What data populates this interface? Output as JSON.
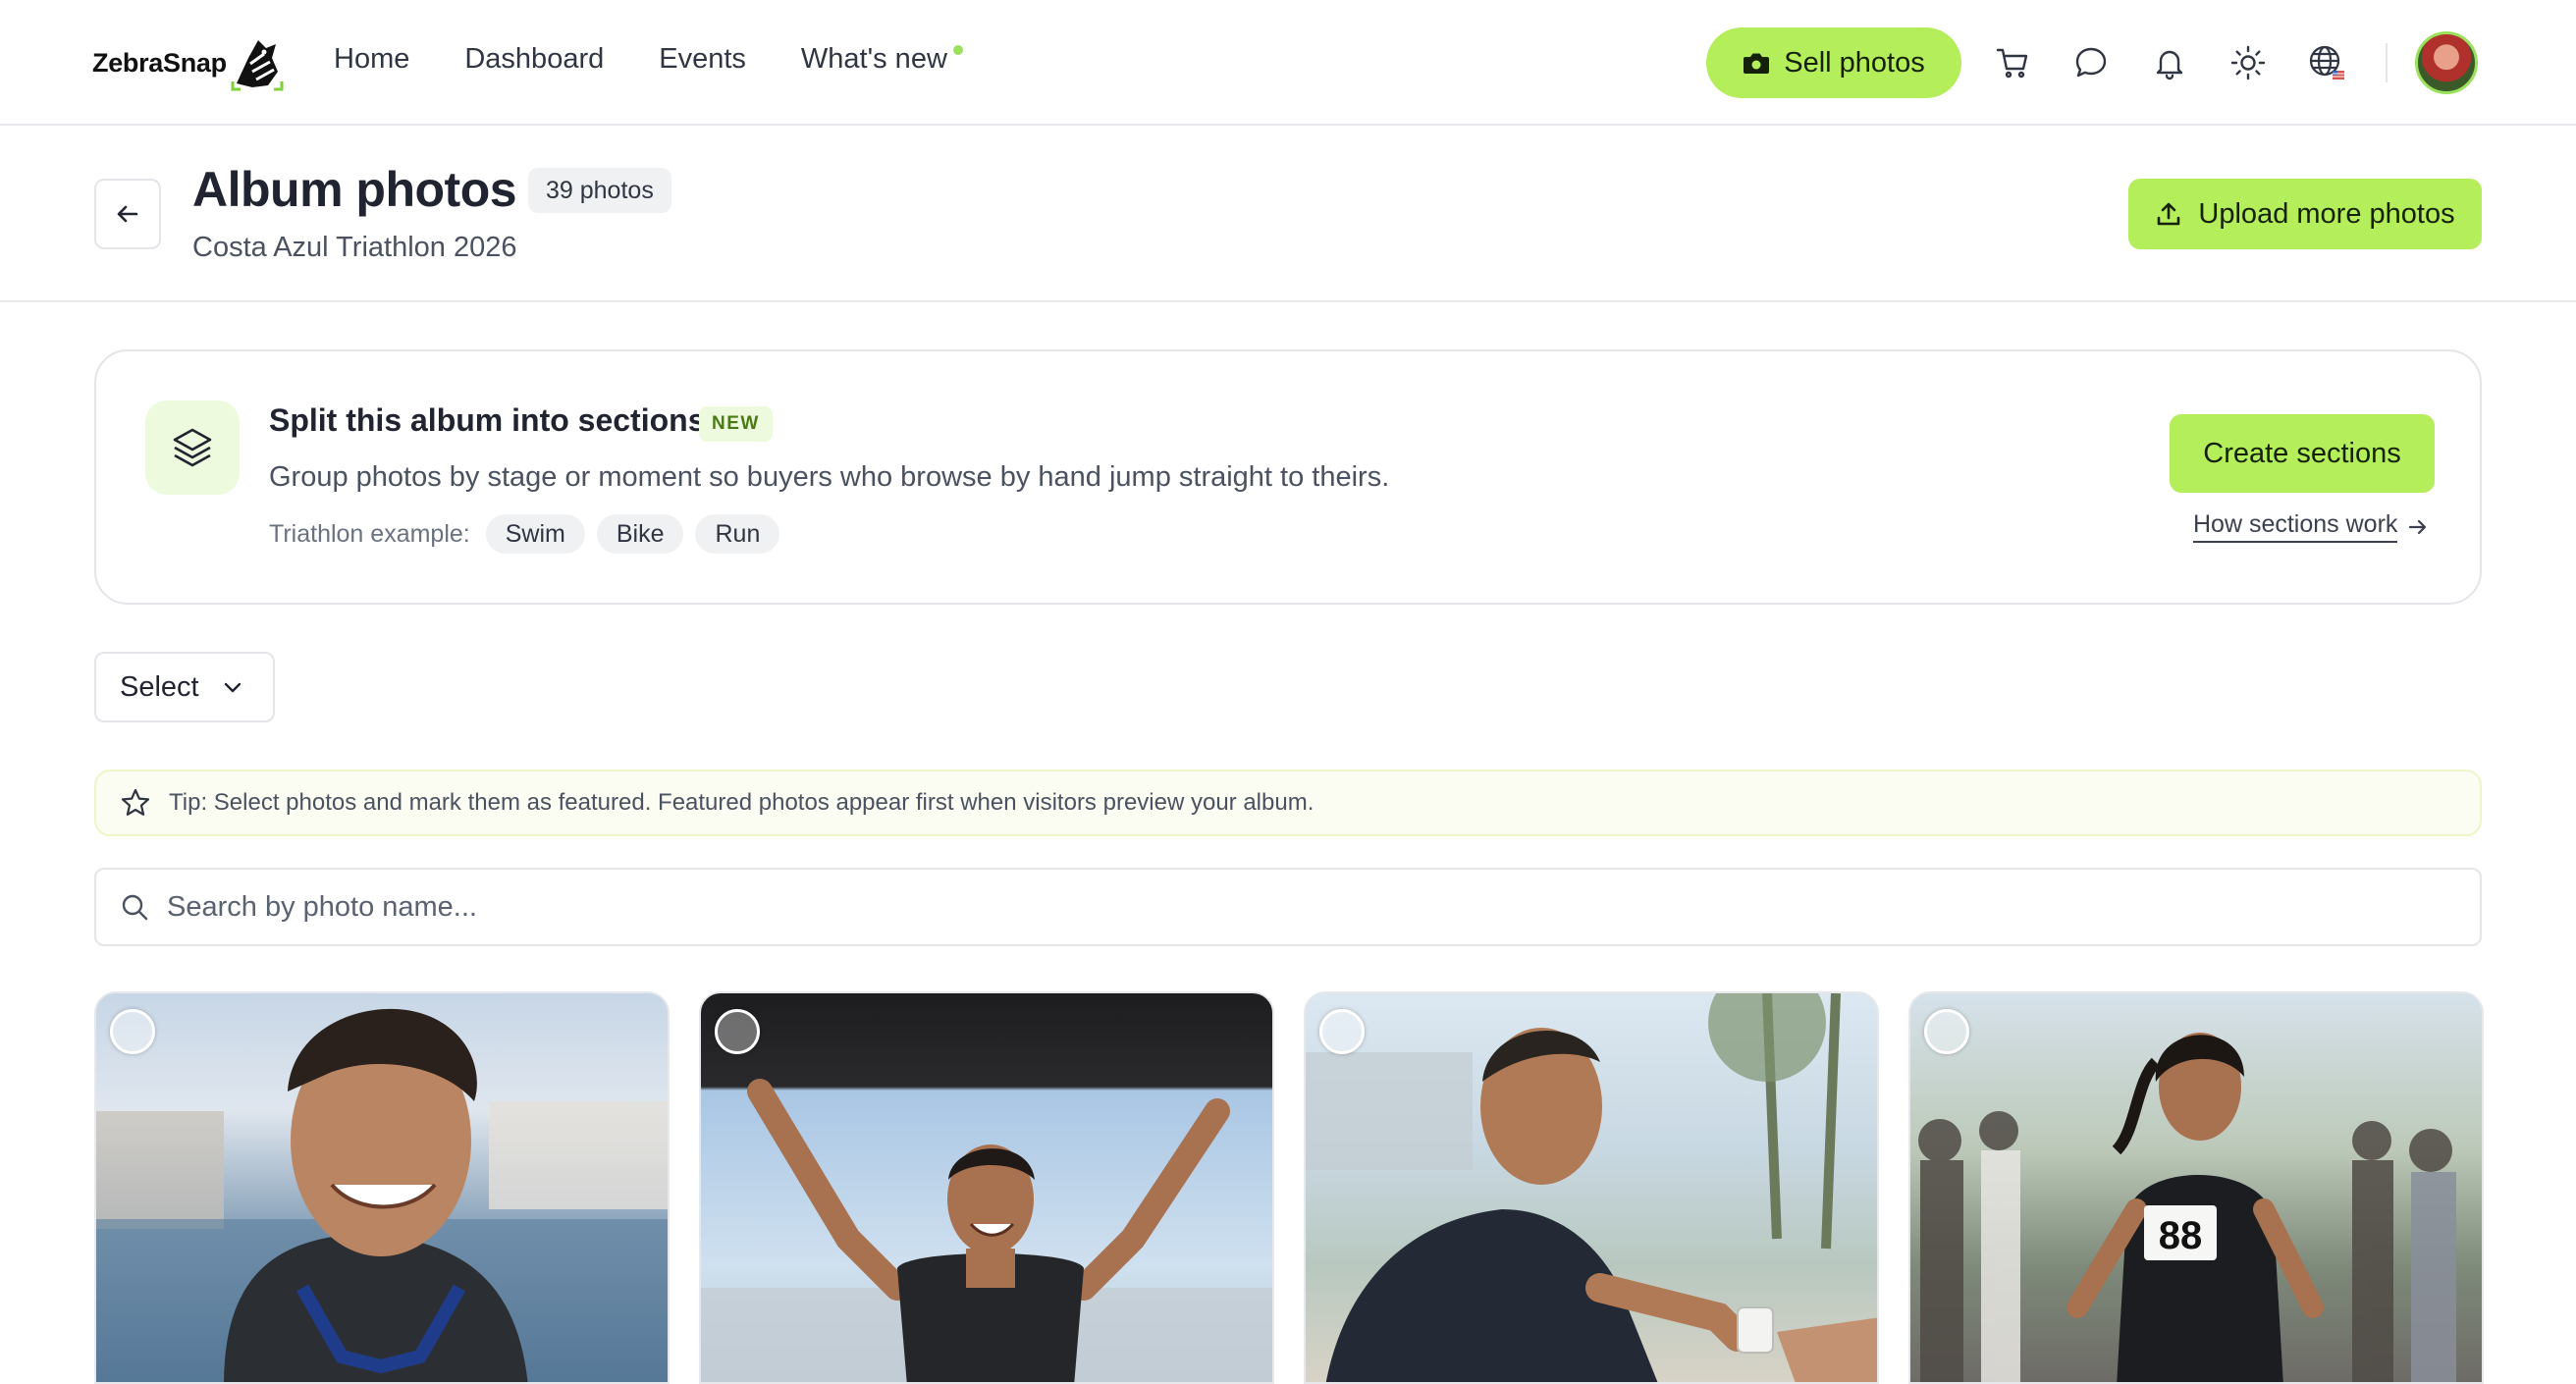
{
  "brand": {
    "name": "ZebraSnap"
  },
  "nav": {
    "links": [
      {
        "label": "Home"
      },
      {
        "label": "Dashboard"
      },
      {
        "label": "Events"
      },
      {
        "label": "What's new",
        "has_new_dot": true
      }
    ],
    "sell_label": "Sell photos",
    "icons": [
      "cart-icon",
      "chat-icon",
      "bell-icon",
      "sun-icon",
      "globe-icon"
    ]
  },
  "header": {
    "title": "Album photos",
    "count_badge": "39 photos",
    "subtitle": "Costa Azul Triathlon 2026",
    "upload_label": "Upload more photos"
  },
  "promo": {
    "title": "Split this album into sections",
    "badge": "NEW",
    "description": "Group photos by stage or moment so buyers who browse by hand jump straight to theirs.",
    "example_label": "Triathlon example:",
    "chips": [
      "Swim",
      "Bike",
      "Run"
    ],
    "create_label": "Create sections",
    "how_label": "How sections work"
  },
  "select": {
    "label": "Select"
  },
  "tip": {
    "text": "Tip: Select photos and mark them as featured. Featured photos appear first when visitors preview your album."
  },
  "search": {
    "placeholder": "Search by photo name..."
  },
  "photos": [
    {
      "selected": false
    },
    {
      "selected": false
    },
    {
      "selected": false
    },
    {
      "selected": false,
      "bib": "88"
    }
  ],
  "colors": {
    "accent": "#b4ee5a",
    "accent_soft": "#eefadd",
    "border": "#e3e5e9",
    "text": "#1f2430"
  }
}
